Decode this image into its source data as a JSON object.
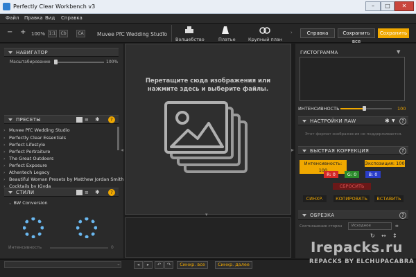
{
  "app": {
    "title": "Perfectly Clear Workbench v3"
  },
  "menu": [
    "Файл",
    "Правка",
    "Вид",
    "Справка"
  ],
  "toolbar": {
    "zoom": "100%",
    "preset_name": "Muvee PfC Wedding Studio",
    "small_buttons": [
      "1:1",
      "Cb",
      "CA"
    ],
    "modes": [
      "Волшебство",
      "Платье",
      "Крупный план"
    ],
    "help": "Справка",
    "save_all": "Сохранить все",
    "save": "Сохранить"
  },
  "navigator": {
    "title": "НАВИГАТОР",
    "scale_label": "Масштабирование",
    "scale_value": "100%",
    "scale": 1.0
  },
  "presets": {
    "title": "ПРЕСЕТЫ",
    "items": [
      "Muvee PfC Wedding Studio",
      "Perfectly Clear Essentials",
      "Perfect Lifestyle",
      "Perfect Portraiture",
      "The Great Outdoors",
      "Perfect Exposure",
      "Athentech Legacy",
      "Beautiful Woman Presets by Matthew Jordan Smith",
      "Cocktails by JGyda"
    ]
  },
  "styles": {
    "title": "СТИЛИ",
    "item": "BW Conversion",
    "intensity_label": "Интенсивность",
    "intensity_value": "0"
  },
  "center": {
    "drop_line1": "Перетащите сюда изображения или",
    "drop_line2": "нажмите здесь и выберите файлы."
  },
  "right": {
    "histogram": "ГИСТОГРАММА",
    "intensity_label": "ИНТЕНСИВНОСТЬ",
    "intensity_value": "100",
    "intensity": 0.6,
    "raw_title": "НАСТРОЙКИ RAW",
    "raw_msg": "Этот формат изображения не поддерживается.",
    "qc_title": "БЫСТРАЯ КОРРЕКЦИЯ",
    "qc_intensity": "Интенсивность: 100",
    "qc_exposure": "Экспозиция: 100",
    "qc_r": "R: 0",
    "qc_g": "G: 0",
    "qc_b": "B: 0",
    "qc_reset": "СБРОСИТЬ",
    "qc_sync": "СИНХР.",
    "qc_copy": "КОПИРОВАТЬ",
    "qc_paste": "ВСТАВИТЬ",
    "crop_title": "ОБРЕЗКА",
    "crop_ratio_label": "Соотношение сторон",
    "crop_ratio": "Исходное"
  },
  "bottom": {
    "sync_all": "Синхр. все",
    "sync_next": "Синхр. далее"
  },
  "watermark": {
    "line1": "Irepacks.ru",
    "line2": "REPACKS BY ELCHUPACABRA"
  }
}
